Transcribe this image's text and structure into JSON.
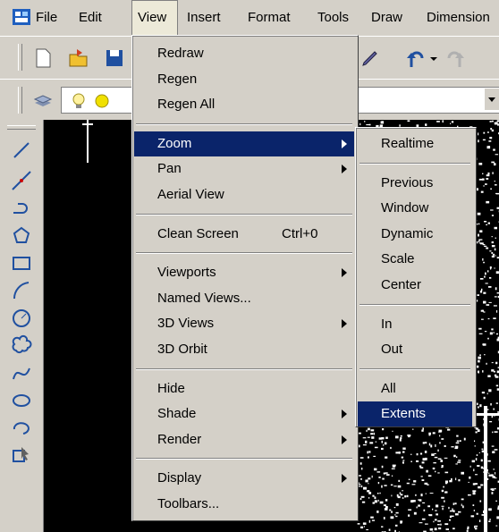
{
  "menubar": {
    "items": [
      "File",
      "Edit",
      "View",
      "Insert",
      "Format",
      "Tools",
      "Draw",
      "Dimension"
    ]
  },
  "view_menu": {
    "groups": [
      [
        {
          "label": "Redraw"
        },
        {
          "label": "Regen"
        },
        {
          "label": "Regen All"
        }
      ],
      [
        {
          "label": "Zoom",
          "submenu": true,
          "highlighted": true
        },
        {
          "label": "Pan",
          "submenu": true
        },
        {
          "label": "Aerial View"
        }
      ],
      [
        {
          "label": "Clean Screen",
          "shortcut": "Ctrl+0"
        }
      ],
      [
        {
          "label": "Viewports",
          "submenu": true
        },
        {
          "label": "Named Views..."
        },
        {
          "label": "3D Views",
          "submenu": true
        },
        {
          "label": "3D Orbit"
        }
      ],
      [
        {
          "label": "Hide"
        },
        {
          "label": "Shade",
          "submenu": true
        },
        {
          "label": "Render",
          "submenu": true
        }
      ],
      [
        {
          "label": "Display",
          "submenu": true
        },
        {
          "label": "Toolbars..."
        }
      ]
    ]
  },
  "zoom_submenu": {
    "groups": [
      [
        {
          "label": "Realtime"
        }
      ],
      [
        {
          "label": "Previous"
        },
        {
          "label": "Window"
        },
        {
          "label": "Dynamic"
        },
        {
          "label": "Scale"
        },
        {
          "label": "Center"
        }
      ],
      [
        {
          "label": "In"
        },
        {
          "label": "Out"
        }
      ],
      [
        {
          "label": "All"
        },
        {
          "label": "Extents",
          "highlighted": true
        }
      ]
    ]
  },
  "colors": {
    "highlight": "#0a246a",
    "face": "#d4d0c8",
    "canvas": "#000000"
  },
  "icons": {
    "toolbar1": [
      "new-file-icon",
      "open-file-icon",
      "save-icon",
      "pencil-icon",
      "undo-icon",
      "redo-icon"
    ],
    "toolbar2": [
      "layers-icon",
      "lightbulb-icon",
      "sun-icon"
    ],
    "draw": [
      "line-icon",
      "construction-line-icon",
      "polyline-icon",
      "polygon-icon",
      "rectangle-icon",
      "arc-icon",
      "circle-icon",
      "revision-cloud-icon",
      "spline-icon",
      "ellipse-icon",
      "ellipse-arc-icon",
      "insert-block-icon"
    ]
  }
}
